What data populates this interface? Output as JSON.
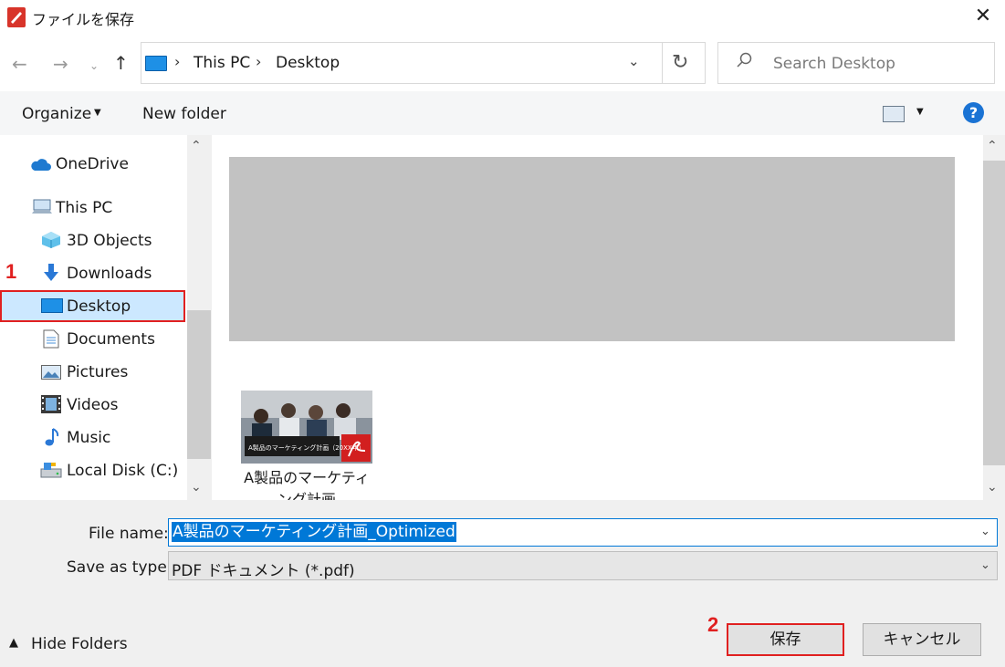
{
  "window": {
    "title": "ファイルを保存",
    "app_icon_text": "PDF"
  },
  "nav": {
    "address_path": [
      "This PC",
      "Desktop"
    ],
    "search_placeholder": "Search Desktop"
  },
  "toolbar": {
    "organize_label": "Organize",
    "new_folder_label": "New folder",
    "help_label": "?"
  },
  "sidebar": {
    "items": [
      {
        "label": "OneDrive",
        "icon": "onedrive-icon"
      },
      {
        "label": "This PC",
        "icon": "computer-icon"
      },
      {
        "label": "3D Objects",
        "icon": "3d-objects-icon"
      },
      {
        "label": "Downloads",
        "icon": "download-arrow-icon"
      },
      {
        "label": "Desktop",
        "icon": "desktop-icon",
        "selected": true
      },
      {
        "label": "Documents",
        "icon": "document-icon"
      },
      {
        "label": "Pictures",
        "icon": "pictures-icon"
      },
      {
        "label": "Videos",
        "icon": "film-icon"
      },
      {
        "label": "Music",
        "icon": "music-note-icon"
      },
      {
        "label": "Local Disk (C:)",
        "icon": "disk-icon"
      }
    ]
  },
  "files": [
    {
      "name": "A製品のマーケティング計画",
      "thumb_caption": "A製品のマーケティング計画（20XX年）"
    }
  ],
  "form": {
    "file_name_label": "File name:",
    "file_name_value": "A製品のマーケティング計画_Optimized",
    "save_type_label": "Save as type:",
    "save_type_value": "PDF ドキュメント (*.pdf)"
  },
  "footer": {
    "hide_folders_label": "Hide Folders",
    "save_label": "保存",
    "cancel_label": "キャンセル"
  },
  "annotations": {
    "step1": "1",
    "step2": "2"
  },
  "colors": {
    "accent": "#0078d7",
    "annotation_red": "#e02020",
    "selection": "#cce8ff"
  }
}
